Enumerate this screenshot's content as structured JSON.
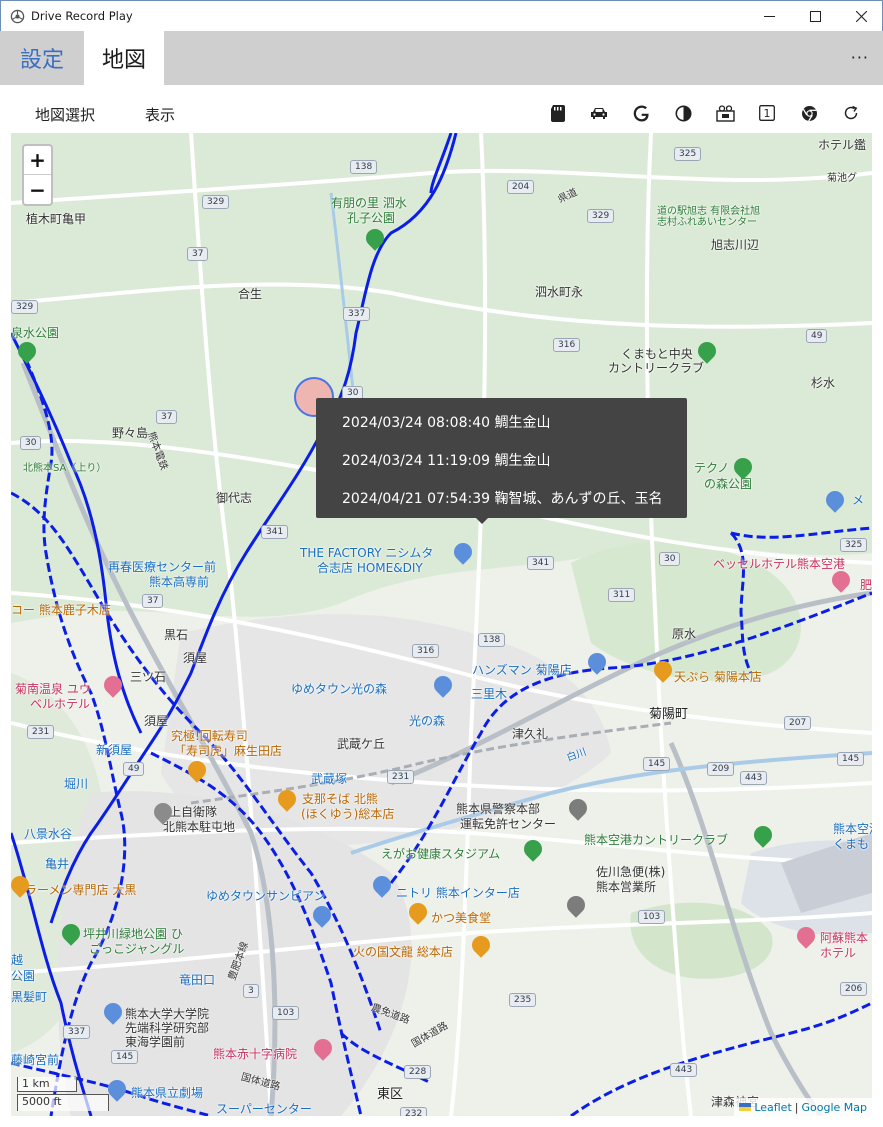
{
  "window": {
    "title": "Drive Record Play",
    "minimize_glyph": "—",
    "maximize_glyph": "□",
    "close_glyph": "✕"
  },
  "tabs": [
    {
      "label": "設定",
      "selected": false
    },
    {
      "label": "地図",
      "selected": true
    }
  ],
  "more_glyph": "···",
  "menu": {
    "items": [
      "地図選択",
      "表示"
    ],
    "tool_icons": [
      "sd-card-icon",
      "car-icon",
      "google-icon",
      "contrast-icon",
      "camera-group-icon",
      "number-one-icon",
      "chrome-icon",
      "refresh-icon"
    ],
    "number_box": "1"
  },
  "map": {
    "zoom_in": "+",
    "zoom_out": "−",
    "popup": {
      "lines": [
        "2024/03/24 08:08:40 鯛生金山",
        "2024/03/24 11:19:09 鯛生金山",
        "2024/04/21 07:54:39 鞠智城、あんずの丘、玉名"
      ]
    },
    "scale": {
      "metric": "1 km",
      "imperial": "5000 ft"
    },
    "attribution": {
      "leaflet": "Leaflet",
      "separator": "|",
      "google": "Google Map"
    },
    "route_color": "#0a1ee6",
    "marker_color": "#f5a3a3",
    "places": [
      "有朋の里 泗水",
      "孔子公園",
      "植木町亀甲",
      "合生",
      "泗水町永",
      "旭志川辺",
      "道の駅旭志 有限会社旭",
      "志村ふれあいセンター",
      "くまもと中央",
      "カントリークラブ",
      "杉水",
      "泉水公園",
      "野々島",
      "北熊本SA（上り）",
      "御代志",
      "熊本電鉄",
      "テクノ",
      "の森公園",
      "THE FACTORY ニシムタ",
      "合志店 HOME&DIY",
      "再春医療センター前",
      "熊本高専前",
      "コー 熊本鹿子木店",
      "ベッセルホテル熊本空港",
      "黒石",
      "須屋",
      "三ツ石",
      "原水",
      "菊南温泉 ユウ",
      "ベルホテル",
      "ゆめタウン光の森",
      "ハンズマン 菊陽店",
      "三里木",
      "天ぷら 菊陽本店",
      "光の森",
      "菊陽町",
      "須屋",
      "究極!回転寿司",
      "「寿司虎」麻生田店",
      "武蔵ケ丘",
      "津久礼",
      "新須屋",
      "堀川",
      "武蔵塚",
      "支那そば 北熊",
      "(ほくゆう)総本店",
      "熊本県警察本部",
      "運転免許センター",
      "陸上自衛隊",
      "北熊本駐屯地",
      "八景水谷",
      "熊本空港カントリークラブ",
      "熊本空港",
      "くまも",
      "えがお健康スタジアム",
      "佐川急便(株)",
      "熊本営業所",
      "亀井",
      "ラーメン専門店 大黒",
      "ゆめタウンサンピアン",
      "ニトリ 熊本インター店",
      "かつ美食堂",
      "坪井川緑地公園 ひ",
      "ごっこジャングル",
      "火の国文龍 総本店",
      "阿蘇熊本",
      "ホテル",
      "越",
      "公園",
      "黒髪町",
      "竜田口",
      "熊本大学大学院",
      "先端科学研究部",
      "東海学園前",
      "農免道路",
      "国体道路",
      "熊本赤十字病院",
      "藤崎宮前",
      "熊本県立劇場",
      "国体道路",
      "東区",
      "スーパーセンター",
      "津森神宮",
      "メ",
      "肥",
      "ホテル鑑",
      "菊池グ",
      "県道",
      "白川",
      "豊肥本線"
    ],
    "road_numbers": [
      "138",
      "329",
      "37",
      "204",
      "325",
      "329",
      "337",
      "329",
      "316",
      "49",
      "37",
      "30",
      "30",
      "37",
      "341",
      "341",
      "30",
      "325",
      "37",
      "311",
      "138",
      "316",
      "231",
      "231",
      "49",
      "145",
      "209",
      "207",
      "145",
      "443",
      "103",
      "206",
      "235",
      "103",
      "228",
      "232",
      "443",
      "145",
      "337",
      "3",
      "3"
    ]
  }
}
